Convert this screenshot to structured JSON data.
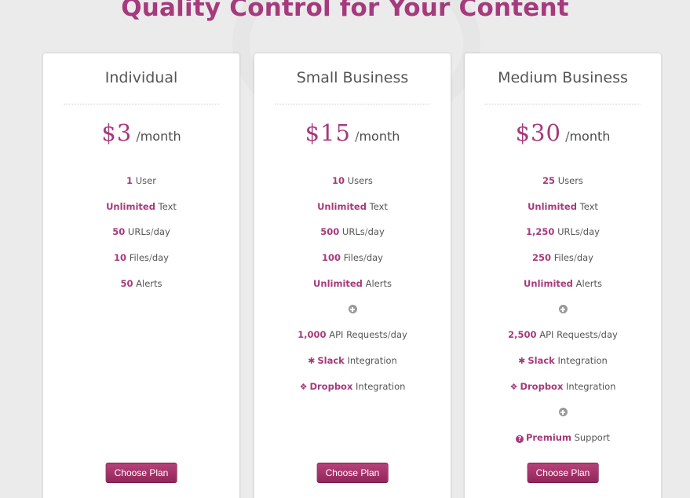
{
  "header": {
    "title": "Quality Control for Your Content"
  },
  "accent_color": "#a53a7c",
  "plans": [
    {
      "name": "Individual",
      "price": "$3",
      "period_sep": "/",
      "period": "month",
      "features": [
        {
          "kind": "text",
          "value": "1",
          "label": "User"
        },
        {
          "kind": "text",
          "value": "Unlimited",
          "label": "Text"
        },
        {
          "kind": "rate",
          "value": "50",
          "label": "URLs",
          "sep": "/",
          "unit": "day"
        },
        {
          "kind": "rate",
          "value": "10",
          "label": "Files",
          "sep": "/",
          "unit": "day"
        },
        {
          "kind": "text",
          "value": "50",
          "label": "Alerts"
        }
      ],
      "button": "Choose Plan"
    },
    {
      "name": "Small Business",
      "price": "$15",
      "period_sep": "/",
      "period": "month",
      "features": [
        {
          "kind": "text",
          "value": "10",
          "label": "Users"
        },
        {
          "kind": "text",
          "value": "Unlimited",
          "label": "Text"
        },
        {
          "kind": "rate",
          "value": "500",
          "label": "URLs",
          "sep": "/",
          "unit": "day"
        },
        {
          "kind": "rate",
          "value": "100",
          "label": "Files",
          "sep": "/",
          "unit": "day"
        },
        {
          "kind": "text",
          "value": "Unlimited",
          "label": "Alerts"
        },
        {
          "kind": "plus",
          "icon": "plus-circle-icon"
        },
        {
          "kind": "rate",
          "value": "1,000",
          "label": "API Requests",
          "sep": "/",
          "unit": "day"
        },
        {
          "kind": "icon",
          "icon": "slack-icon",
          "value": "Slack",
          "label": "Integration"
        },
        {
          "kind": "icon",
          "icon": "dropbox-icon",
          "value": "Dropbox",
          "label": "Integration"
        }
      ],
      "button": "Choose Plan"
    },
    {
      "name": "Medium Business",
      "price": "$30",
      "period_sep": "/",
      "period": "month",
      "features": [
        {
          "kind": "text",
          "value": "25",
          "label": "Users"
        },
        {
          "kind": "text",
          "value": "Unlimited",
          "label": "Text"
        },
        {
          "kind": "rate",
          "value": "1,250",
          "label": "URLs",
          "sep": "/",
          "unit": "day"
        },
        {
          "kind": "rate",
          "value": "250",
          "label": "Files",
          "sep": "/",
          "unit": "day"
        },
        {
          "kind": "text",
          "value": "Unlimited",
          "label": "Alerts"
        },
        {
          "kind": "plus",
          "icon": "plus-circle-icon"
        },
        {
          "kind": "rate",
          "value": "2,500",
          "label": "API Requests",
          "sep": "/",
          "unit": "day"
        },
        {
          "kind": "icon",
          "icon": "slack-icon",
          "value": "Slack",
          "label": "Integration"
        },
        {
          "kind": "icon",
          "icon": "dropbox-icon",
          "value": "Dropbox",
          "label": "Integration"
        },
        {
          "kind": "plus",
          "icon": "plus-circle-icon"
        },
        {
          "kind": "icon",
          "icon": "question-circle-icon",
          "value": "Premium",
          "label": "Support"
        }
      ],
      "button": "Choose Plan"
    }
  ]
}
